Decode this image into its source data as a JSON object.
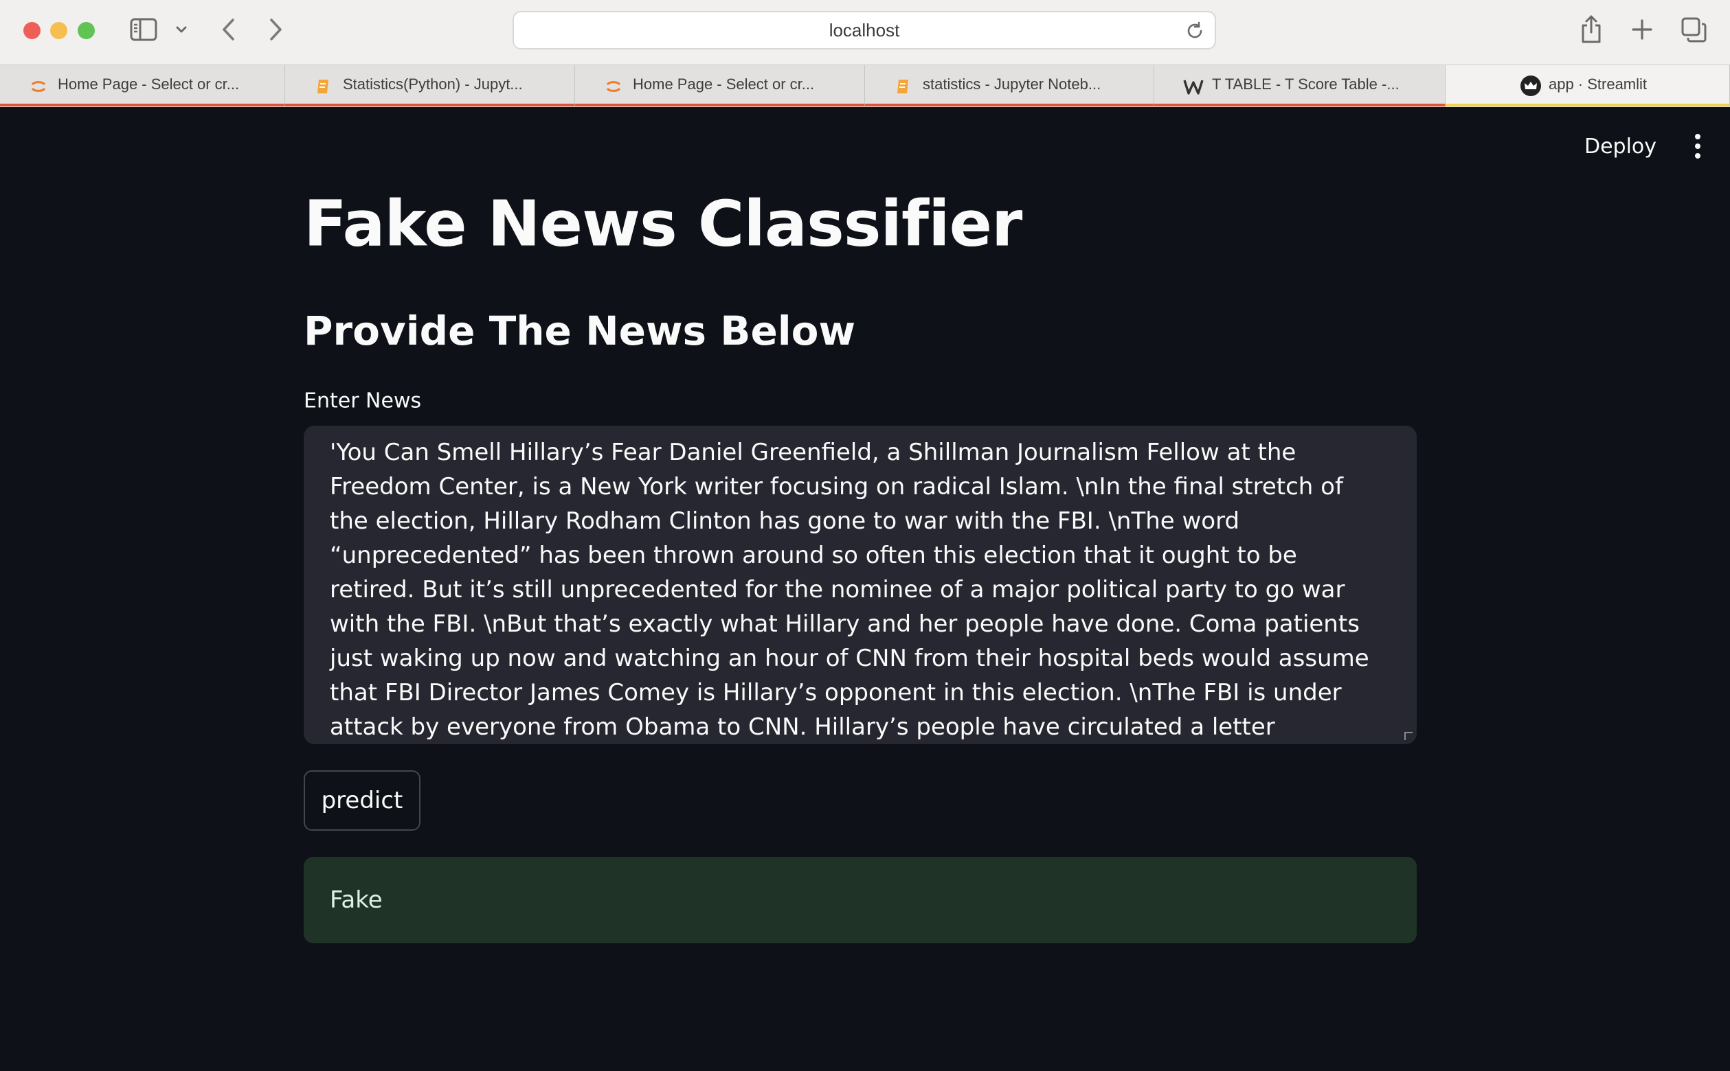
{
  "browser": {
    "url": "localhost",
    "tabs": [
      {
        "label": "Home Page - Select or cr...",
        "icon": "jupyter-icon"
      },
      {
        "label": "Statistics(Python) - Jupyt...",
        "icon": "notebook-icon"
      },
      {
        "label": "Home Page - Select or cr...",
        "icon": "jupyter-icon"
      },
      {
        "label": "statistics - Jupyter Noteb...",
        "icon": "notebook-icon"
      },
      {
        "label": "T TABLE - T Score Table -...",
        "icon": "w-logo-icon"
      },
      {
        "label": "app · Streamlit",
        "icon": "streamlit-crown-icon",
        "active": true
      }
    ]
  },
  "header": {
    "deploy_label": "Deploy"
  },
  "main": {
    "title": "Fake News Classifier",
    "subheader": "Provide The News Below",
    "input_label": "Enter News",
    "input_value": "'You Can Smell Hillary’s Fear Daniel Greenfield, a Shillman Journalism Fellow at the Freedom Center, is a New York writer focusing on radical Islam. \\nIn the final stretch of the election, Hillary Rodham Clinton has gone to war with the FBI. \\nThe word “unprecedented” has been thrown around so often this election that it ought to be retired. But it’s still unprecedented for the nominee of a major political party to go war with the FBI. \\nBut that’s exactly what Hillary and her people have done. Coma patients just waking up now and watching an hour of CNN from their hospital beds would assume that FBI Director James Comey is Hillary’s opponent in this election. \\nThe FBI is under attack by everyone from Obama to CNN. Hillary’s people have circulated a letter attacking Comey. There are currently more media hit pieces lambasting him than targeting Trump. It wouldn’t",
    "predict_label": "predict",
    "result": "Fake"
  },
  "colors": {
    "app_background": "#0e1117",
    "textarea_background": "#262730",
    "success_background": "#1f3326",
    "tab_accent_red": "#e0523a",
    "tab_accent_yellow": "#f1d24a"
  }
}
